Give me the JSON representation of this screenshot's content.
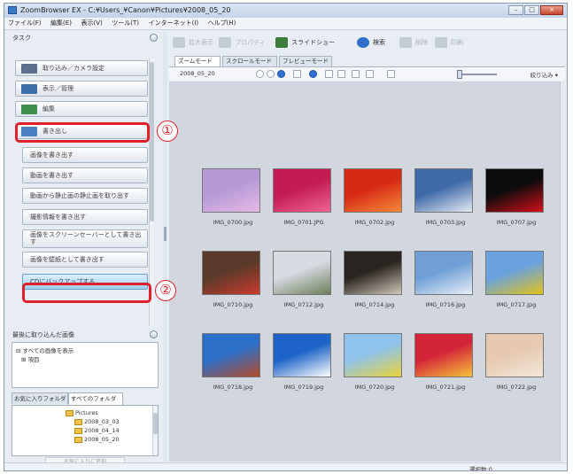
{
  "window": {
    "title": "ZoomBrowser EX - C:¥Users_¥Canon¥Pictures¥2008_05_20",
    "controls": [
      "–",
      "□",
      "×"
    ]
  },
  "menu": [
    "ファイル(F)",
    "編集(E)",
    "表示(V)",
    "ツール(T)",
    "インターネット(I)",
    "ヘルプ(H)"
  ],
  "task_panel": {
    "header": "タスク",
    "main_buttons": [
      {
        "label": "取り込み／カメラ設定",
        "icon": "camera-icon",
        "color": "#5a6f8c"
      },
      {
        "label": "表示／管理",
        "icon": "view-icon",
        "color": "#3e6ea8"
      },
      {
        "label": "編集",
        "icon": "edit-icon",
        "color": "#3f8f4a"
      },
      {
        "label": "書き出し",
        "icon": "export-icon",
        "color": "#4a7fc1"
      }
    ],
    "sub_buttons": [
      "画像を書き出す",
      "動画を書き出す",
      "動画から静止画の静止画を取り出す",
      "撮影情報を書き出す",
      "画像をスクリーンセーバーとして書き出す",
      "画像を壁紙として書き出す",
      "CDにバックアップする"
    ],
    "annotations": [
      "①",
      "②"
    ]
  },
  "recent": {
    "header": "最後に取り込んだ画像",
    "items": [
      "すべての画像を表示",
      "項目"
    ]
  },
  "folder_panel": {
    "tabs": [
      "お気に入りフォルダ",
      "すべてのフォルダ"
    ],
    "tree": [
      "Pictures",
      "2008_03_03",
      "2008_04_14",
      "2008_05_20"
    ],
    "add_label": "お気に入りに追加"
  },
  "toolbar": {
    "items": [
      {
        "label": "拡大表示",
        "enabled": false,
        "icon": "zoom-view-icon"
      },
      {
        "label": "プロパティ",
        "enabled": false,
        "icon": "properties-icon"
      },
      {
        "label": "スライドショー",
        "enabled": true,
        "icon": "slideshow-icon"
      },
      {
        "label": "検索",
        "enabled": true,
        "icon": "search-icon"
      },
      {
        "label": "削除",
        "enabled": false,
        "icon": "delete-icon"
      },
      {
        "label": "印刷",
        "enabled": false,
        "icon": "print-icon"
      }
    ]
  },
  "view_tabs": [
    "ズームモード",
    "スクロールモード",
    "プレビューモード"
  ],
  "view_bar": {
    "path": "2008_05_20",
    "narrow_label": "絞り込み ▾"
  },
  "thumbnails": [
    {
      "name": "IMG_0700.jpg",
      "colors": [
        "#b59ad6",
        "#e7b8e6"
      ]
    },
    {
      "name": "IMG_0701.JPG",
      "colors": [
        "#c21c52",
        "#f06496"
      ]
    },
    {
      "name": "IMG_0702.jpg",
      "colors": [
        "#d62a14",
        "#f68a3a"
      ]
    },
    {
      "name": "IMG_0703.jpg",
      "colors": [
        "#3f6aa8",
        "#e3e9f2"
      ]
    },
    {
      "name": "IMG_0707.jpg",
      "colors": [
        "#0c0c0c",
        "#d3101c"
      ]
    },
    {
      "name": "IMG_0710.jpg",
      "colors": [
        "#5a3a2a",
        "#c93b2c"
      ]
    },
    {
      "name": "IMG_0712.jpg",
      "colors": [
        "#d7dbe2",
        "#6d7d5a"
      ]
    },
    {
      "name": "IMG_0714.jpg",
      "colors": [
        "#2a2420",
        "#cfc7b8"
      ]
    },
    {
      "name": "IMG_0716.jpg",
      "colors": [
        "#6f9fd6",
        "#e7eef6"
      ]
    },
    {
      "name": "IMG_0717.jpg",
      "colors": [
        "#6aa2e0",
        "#e2c21a"
      ]
    },
    {
      "name": "IMG_0718.jpg",
      "colors": [
        "#2c6fc8",
        "#b34a2a"
      ]
    },
    {
      "name": "IMG_0719.jpg",
      "colors": [
        "#1e64c8",
        "#ffffff"
      ]
    },
    {
      "name": "IMG_0720.jpg",
      "colors": [
        "#8fc3ec",
        "#e8d23a"
      ]
    },
    {
      "name": "IMG_0721.jpg",
      "colors": [
        "#d4243a",
        "#f6c23a"
      ]
    },
    {
      "name": "IMG_0722.jpg",
      "colors": [
        "#e6c9b0",
        "#f3e7d8"
      ]
    }
  ],
  "status": {
    "text": "選択数:0"
  }
}
